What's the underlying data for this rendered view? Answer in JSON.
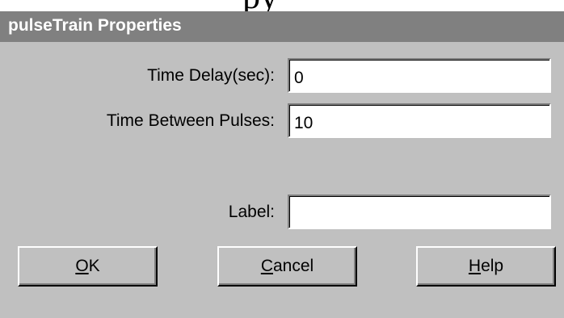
{
  "background_text": "py",
  "dialog": {
    "title": "pulseTrain Properties",
    "fields": [
      {
        "label": "Time Delay(sec):",
        "value": "0"
      },
      {
        "label": "Time Between Pulses:",
        "value": "10"
      },
      {
        "label": "Label:",
        "value": ""
      }
    ],
    "buttons": [
      {
        "mnemonic": "O",
        "rest": "K"
      },
      {
        "mnemonic": "C",
        "rest": "ancel"
      },
      {
        "mnemonic": "H",
        "rest": "elp"
      }
    ]
  },
  "colors": {
    "dialog_bg": "#c0c0c0",
    "titlebar_bg": "#808080",
    "title_text": "#ffffff"
  }
}
